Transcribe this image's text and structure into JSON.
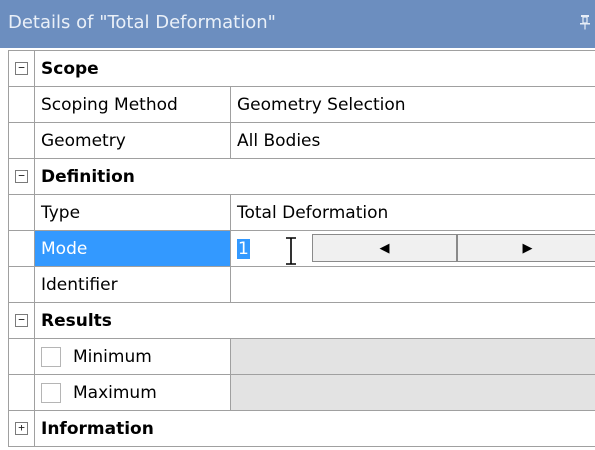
{
  "panel": {
    "title": "Details of \"Total Deformation\"",
    "pin_icon": "pin-icon"
  },
  "groups": {
    "scope": {
      "label": "Scope",
      "toggle": "−",
      "rows": [
        {
          "label": "Scoping Method",
          "value": "Geometry Selection"
        },
        {
          "label": "Geometry",
          "value": "All Bodies"
        }
      ]
    },
    "definition": {
      "label": "Definition",
      "toggle": "−",
      "type": {
        "label": "Type",
        "value": "Total Deformation"
      },
      "mode": {
        "label": "Mode",
        "value": "1"
      },
      "identifier": {
        "label": "Identifier",
        "value": ""
      }
    },
    "results": {
      "label": "Results",
      "toggle": "−",
      "rows": [
        {
          "label": "Minimum",
          "value": ""
        },
        {
          "label": "Maximum",
          "value": ""
        }
      ]
    },
    "information": {
      "label": "Information",
      "toggle": "+"
    }
  },
  "spinner": {
    "left_icon": "◀",
    "right_icon": "▶"
  },
  "colors": {
    "header_bg": "#6c8ebf",
    "selection": "#3399ff",
    "disabled_bg": "#e3e3e3"
  }
}
